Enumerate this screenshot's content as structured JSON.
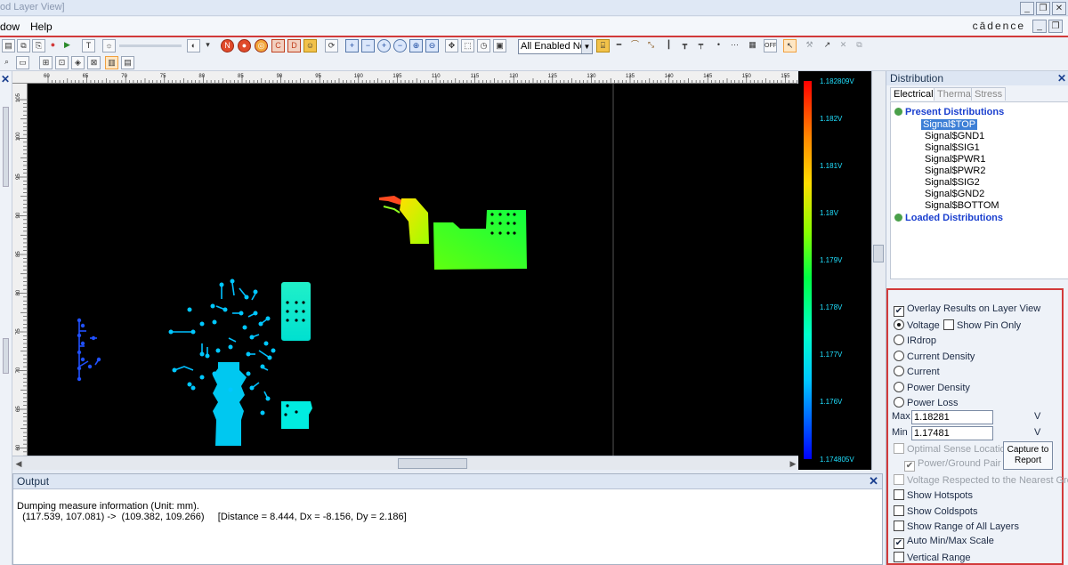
{
  "window": {
    "title": "od Layer View]",
    "brand": "cādence"
  },
  "menu": {
    "items": [
      "dow",
      "Help"
    ]
  },
  "toolbar": {
    "layer_select": "All Enabled Ne"
  },
  "output": {
    "title": "Output",
    "lines": [
      "Dumping measure information (Unit: mm).",
      "  (117.539, 107.081) ->  (109.382, 109.266)     [Distance = 8.444, Dx = -8.156, Dy = 2.186]"
    ]
  },
  "legend": {
    "labels": [
      "1.182809V",
      "1.182V",
      "1.181V",
      "1.18V",
      "1.179V",
      "1.178V",
      "1.177V",
      "1.176V",
      "1.174805V"
    ]
  },
  "ruler": {
    "top_ticks": [
      "60",
      "65",
      "70",
      "75",
      "80",
      "85",
      "90",
      "95",
      "100",
      "105",
      "110",
      "115",
      "120",
      "125",
      "130",
      "135",
      "140",
      "145",
      "150",
      "155"
    ],
    "left_ticks": [
      "105",
      "100",
      "95",
      "90",
      "85",
      "80",
      "75",
      "70",
      "65",
      "60",
      "55",
      "50"
    ]
  },
  "panel": {
    "title": "Distribution",
    "tabs": [
      "Electrical",
      "Thermal",
      "Stress"
    ],
    "tree": {
      "present": "Present Distributions",
      "signals": [
        "Signal$TOP",
        "Signal$GND1",
        "Signal$SIG1",
        "Signal$PWR1",
        "Signal$PWR2",
        "Signal$SIG2",
        "Signal$GND2",
        "Signal$BOTTOM"
      ],
      "loaded": "Loaded Distributions"
    },
    "options": {
      "overlay": "Overlay Results on Layer View",
      "voltage": "Voltage",
      "show_pin_only": "Show Pin Only",
      "irdrop": "IRdrop",
      "current_density": "Current Density",
      "current": "Current",
      "power_density": "Power Density",
      "power_loss": "Power Loss",
      "max_label": "Max",
      "max_value": "1.18281",
      "min_label": "Min",
      "min_value": "1.17481",
      "unit": "V",
      "optimal_sense": "Optimal Sense Locations",
      "capture": "Capture to Report",
      "power_ground_pair": "Power/Ground Pair",
      "voltage_respected": "Voltage Respected to the Nearest Ground P",
      "show_hotspots": "Show Hotspots",
      "show_coldspots": "Show Coldspots",
      "show_range": "Show Range of All Layers",
      "auto_minmax": "Auto Min/Max Scale",
      "vertical_range": "Vertical Range"
    }
  },
  "colors": {
    "accent_red": "#d23a3a",
    "canvas": "#000000",
    "tree_root": "#1a3fcf",
    "legend_text": "#20e0ff"
  }
}
